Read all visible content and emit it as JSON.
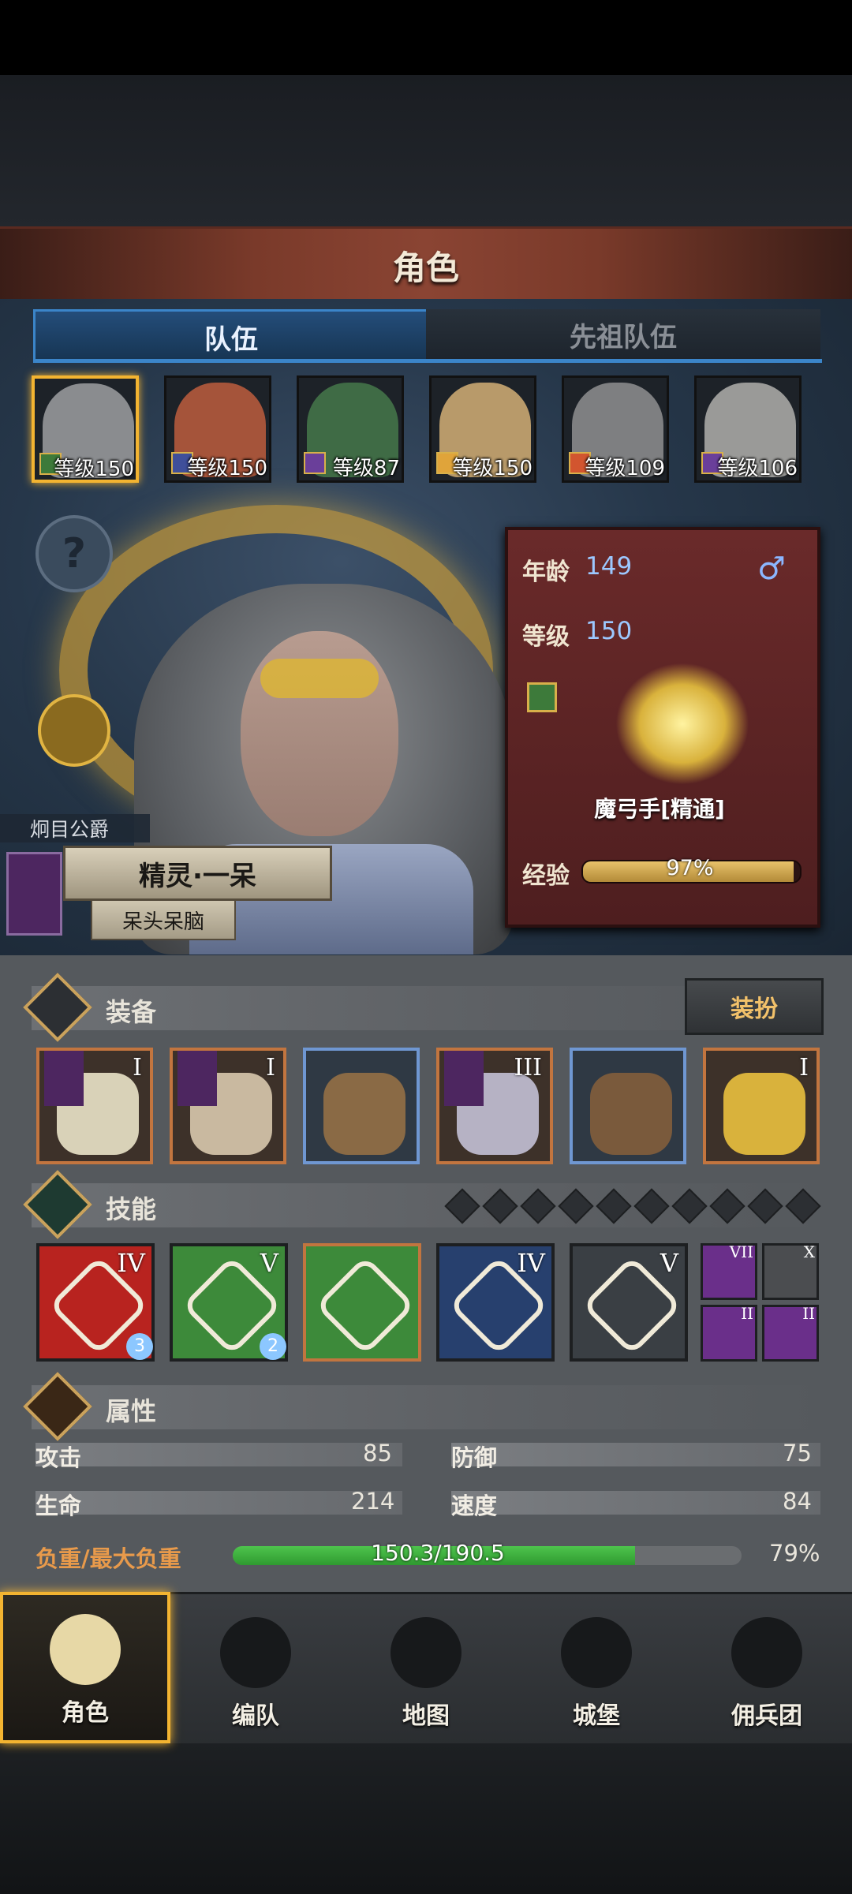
{
  "header": {
    "title": "角色"
  },
  "tabs": [
    {
      "label": "队伍",
      "active": true
    },
    {
      "label": "先祖队伍",
      "active": false
    }
  ],
  "party": [
    {
      "level": "等级150",
      "class_color": "#3d7a3a",
      "face_color": "#8a8c8f",
      "selected": true
    },
    {
      "level": "等级150",
      "class_color": "#3f4f9a",
      "face_color": "#a5543a",
      "selected": false
    },
    {
      "level": "等级87",
      "class_color": "#6a3f9a",
      "face_color": "#3f6b45",
      "selected": false
    },
    {
      "level": "等级150",
      "class_color": "#e0a43a",
      "face_color": "#b89a6a",
      "selected": false
    },
    {
      "level": "等级109",
      "class_color": "#d2552f",
      "face_color": "#7e7f81",
      "selected": false
    },
    {
      "level": "等级106",
      "class_color": "#6a3f9a",
      "face_color": "#9a9a98",
      "selected": false
    }
  ],
  "help": {
    "icon": "?"
  },
  "character": {
    "rank_title": "炯目公爵",
    "name": "精灵·一呆",
    "nickname": "呆头呆脑",
    "age_label": "年龄",
    "age": "149",
    "level_label": "等级",
    "level": "150",
    "gender_icon": "♂",
    "class_name": "魔弓手[精通]",
    "exp_label": "经验",
    "exp_text": "97%",
    "exp_fraction": 0.97
  },
  "equipment": {
    "title": "装备",
    "dress_button": "装扮",
    "slots": [
      {
        "tier": "I",
        "frame": "orange",
        "flag": true,
        "art": "#d9d2b8"
      },
      {
        "tier": "I",
        "frame": "orange",
        "flag": true,
        "art": "#c9b9a0"
      },
      {
        "tier": "",
        "frame": "blue",
        "flag": false,
        "art": "#8a6a45"
      },
      {
        "tier": "III",
        "frame": "orange",
        "flag": true,
        "art": "#b6b2c4"
      },
      {
        "tier": "",
        "frame": "blue",
        "flag": false,
        "art": "#7a5a3c"
      },
      {
        "tier": "I",
        "frame": "orange",
        "flag": false,
        "art": "#d9b23c"
      }
    ]
  },
  "skills": {
    "title": "技能",
    "diamond_count": 10,
    "active": [
      {
        "tier": "IV",
        "bg": "#b8231f",
        "badge": "3",
        "gold": false
      },
      {
        "tier": "V",
        "bg": "#3d8a3a",
        "badge": "2",
        "gold": false
      },
      {
        "tier": "",
        "bg": "#3d8a3a",
        "badge": "",
        "gold": true
      },
      {
        "tier": "IV",
        "bg": "#27406e",
        "badge": "",
        "gold": false
      },
      {
        "tier": "V",
        "bg": "#3a3f44",
        "badge": "",
        "gold": false
      }
    ],
    "passive": [
      {
        "tier": "VII",
        "bg": "#6a2f8a"
      },
      {
        "tier": "X",
        "bg": "#4b4d50"
      },
      {
        "tier": "II",
        "bg": "#6a2f8a"
      },
      {
        "tier": "II",
        "bg": "#6a2f8a"
      }
    ]
  },
  "attributes": {
    "title": "属性",
    "attack_label": "攻击",
    "attack": "85",
    "defense_label": "防御",
    "defense": "75",
    "hp_label": "生命",
    "hp": "214",
    "speed_label": "速度",
    "speed": "84",
    "load_label": "负重/最大负重",
    "load_text": "150.3/190.5",
    "load_pct": "79%",
    "load_fraction": 0.79
  },
  "nav": [
    {
      "label": "角色",
      "active": true
    },
    {
      "label": "编队",
      "active": false
    },
    {
      "label": "地图",
      "active": false
    },
    {
      "label": "城堡",
      "active": false
    },
    {
      "label": "佣兵团",
      "active": false
    }
  ],
  "colors": {
    "accent_gold": "#f3b431",
    "tab_blue": "#3b85c9",
    "load_green": "#3fb040",
    "load_label": "#e89a4b"
  }
}
